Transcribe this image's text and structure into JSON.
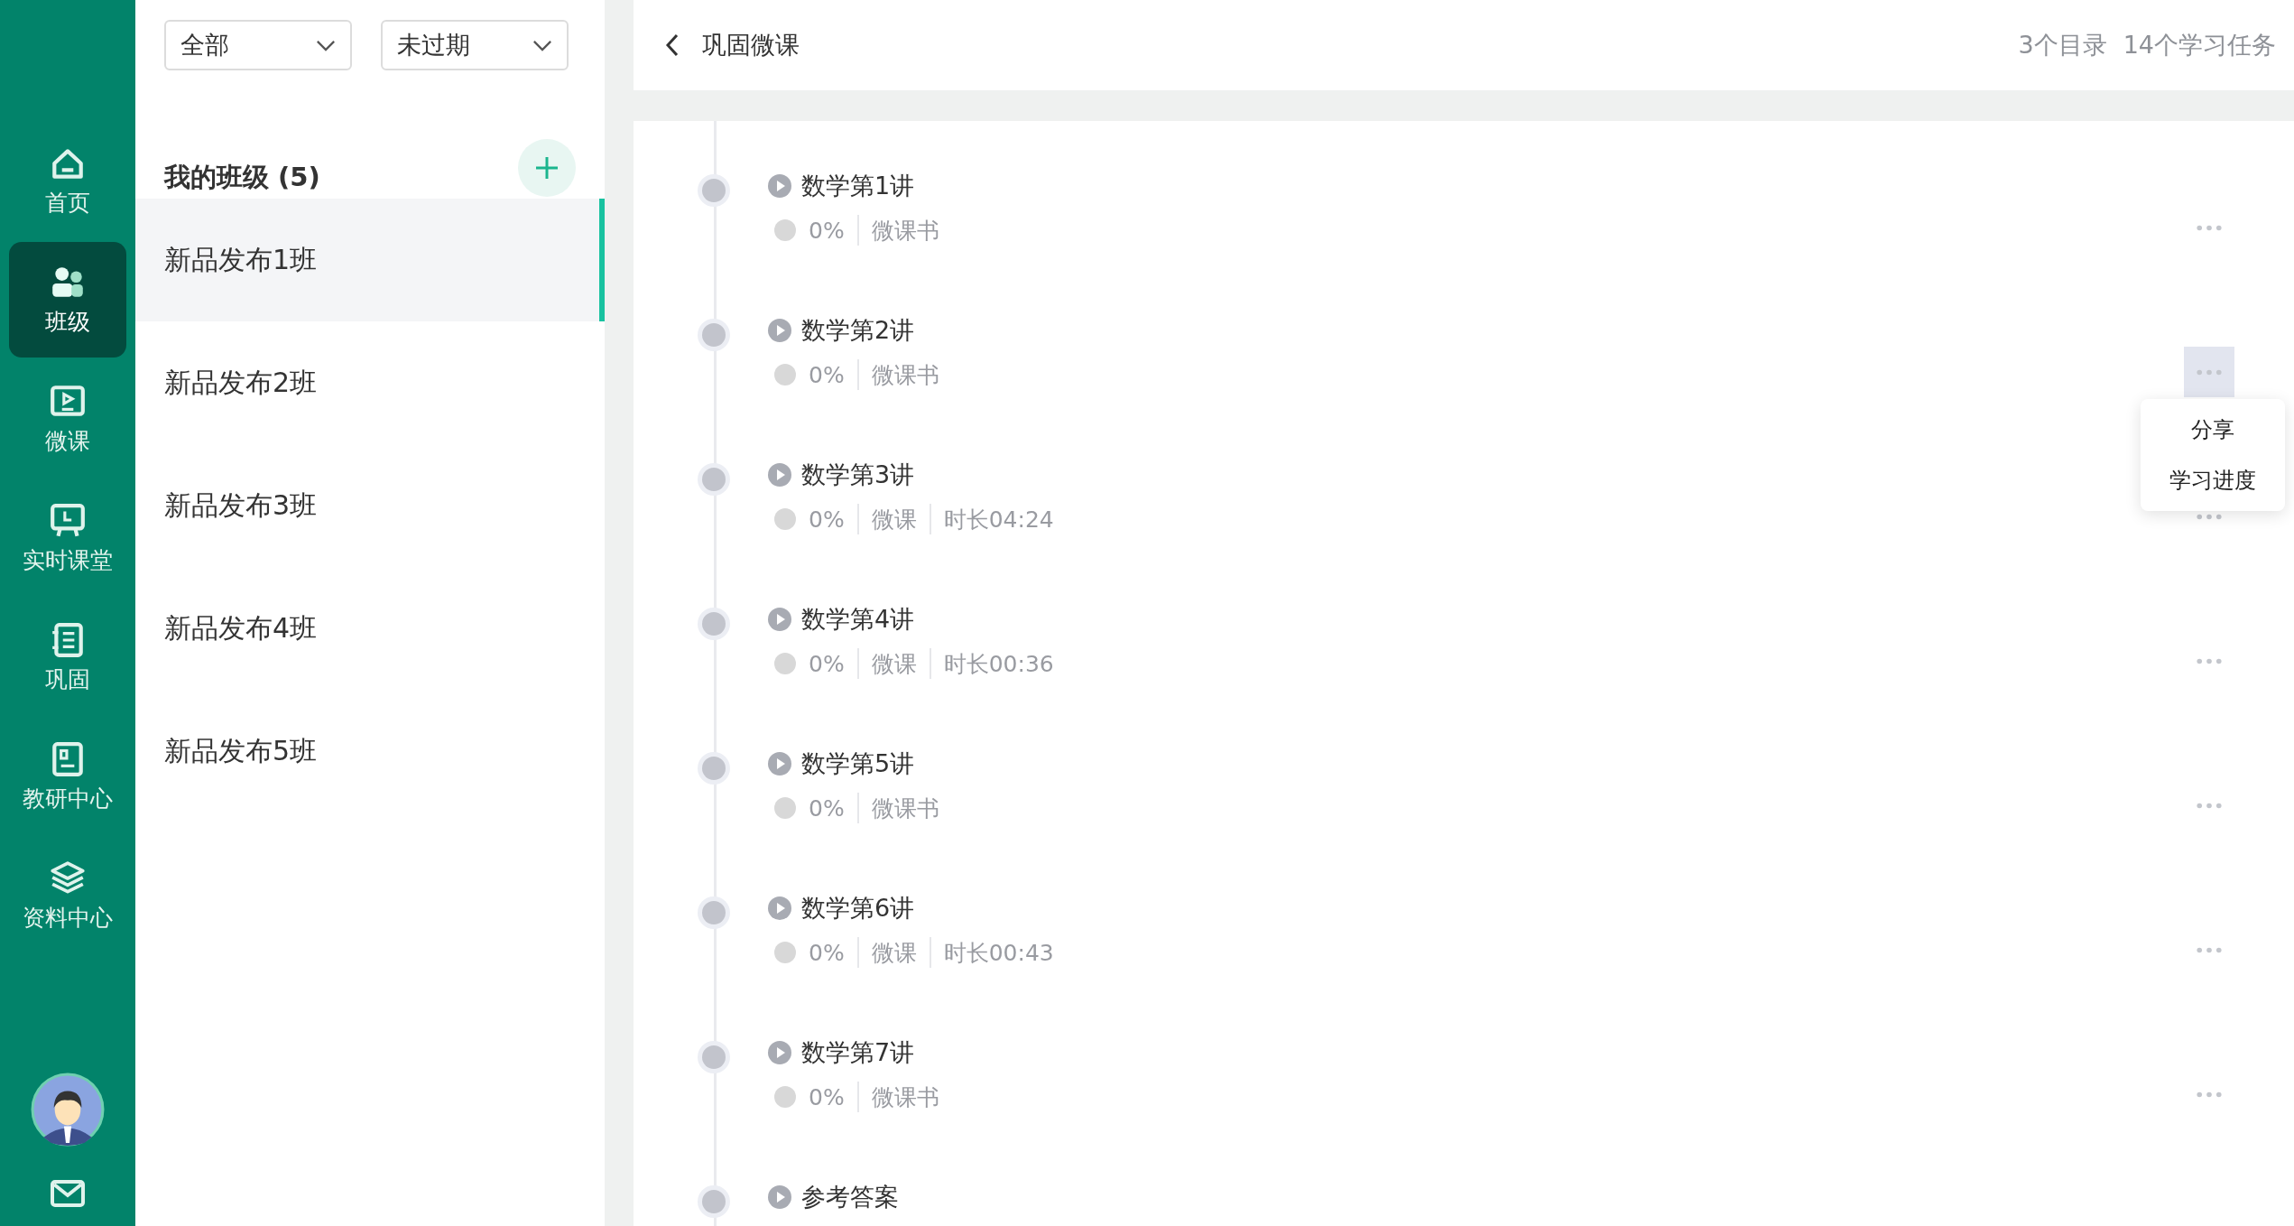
{
  "nav": [
    {
      "label": "首页",
      "selected": false
    },
    {
      "label": "班级",
      "selected": true
    },
    {
      "label": "微课",
      "selected": false
    },
    {
      "label": "实时课堂",
      "selected": false
    },
    {
      "label": "巩固",
      "selected": false
    },
    {
      "label": "教研中心",
      "selected": false
    },
    {
      "label": "资料中心",
      "selected": false
    }
  ],
  "filters": [
    {
      "value": "全部"
    },
    {
      "value": "未过期"
    }
  ],
  "class_list": {
    "title": "我的班级 (5)",
    "items": [
      {
        "label": "新品发布1班",
        "selected": true
      },
      {
        "label": "新品发布2班",
        "selected": false
      },
      {
        "label": "新品发布3班",
        "selected": false
      },
      {
        "label": "新品发布4班",
        "selected": false
      },
      {
        "label": "新品发布5班",
        "selected": false
      }
    ]
  },
  "header": {
    "title": "巩固微课",
    "stats": [
      "3个目录",
      "14个学习任务"
    ]
  },
  "lessons": [
    {
      "title": "数学第1讲",
      "progress": "0%",
      "type": "微课书",
      "menu_open": false
    },
    {
      "title": "数学第2讲",
      "progress": "0%",
      "type": "微课书",
      "menu_open": true
    },
    {
      "title": "数学第3讲",
      "progress": "0%",
      "type": "微课",
      "duration": "时长04:24",
      "menu_open": false
    },
    {
      "title": "数学第4讲",
      "progress": "0%",
      "type": "微课",
      "duration": "时长00:36",
      "menu_open": false
    },
    {
      "title": "数学第5讲",
      "progress": "0%",
      "type": "微课书",
      "menu_open": false
    },
    {
      "title": "数学第6讲",
      "progress": "0%",
      "type": "微课",
      "duration": "时长00:43",
      "menu_open": false
    },
    {
      "title": "数学第7讲",
      "progress": "0%",
      "type": "微课书",
      "menu_open": false
    },
    {
      "title": "参考答案"
    }
  ],
  "popup_menu": [
    "分享",
    "学习进度"
  ]
}
